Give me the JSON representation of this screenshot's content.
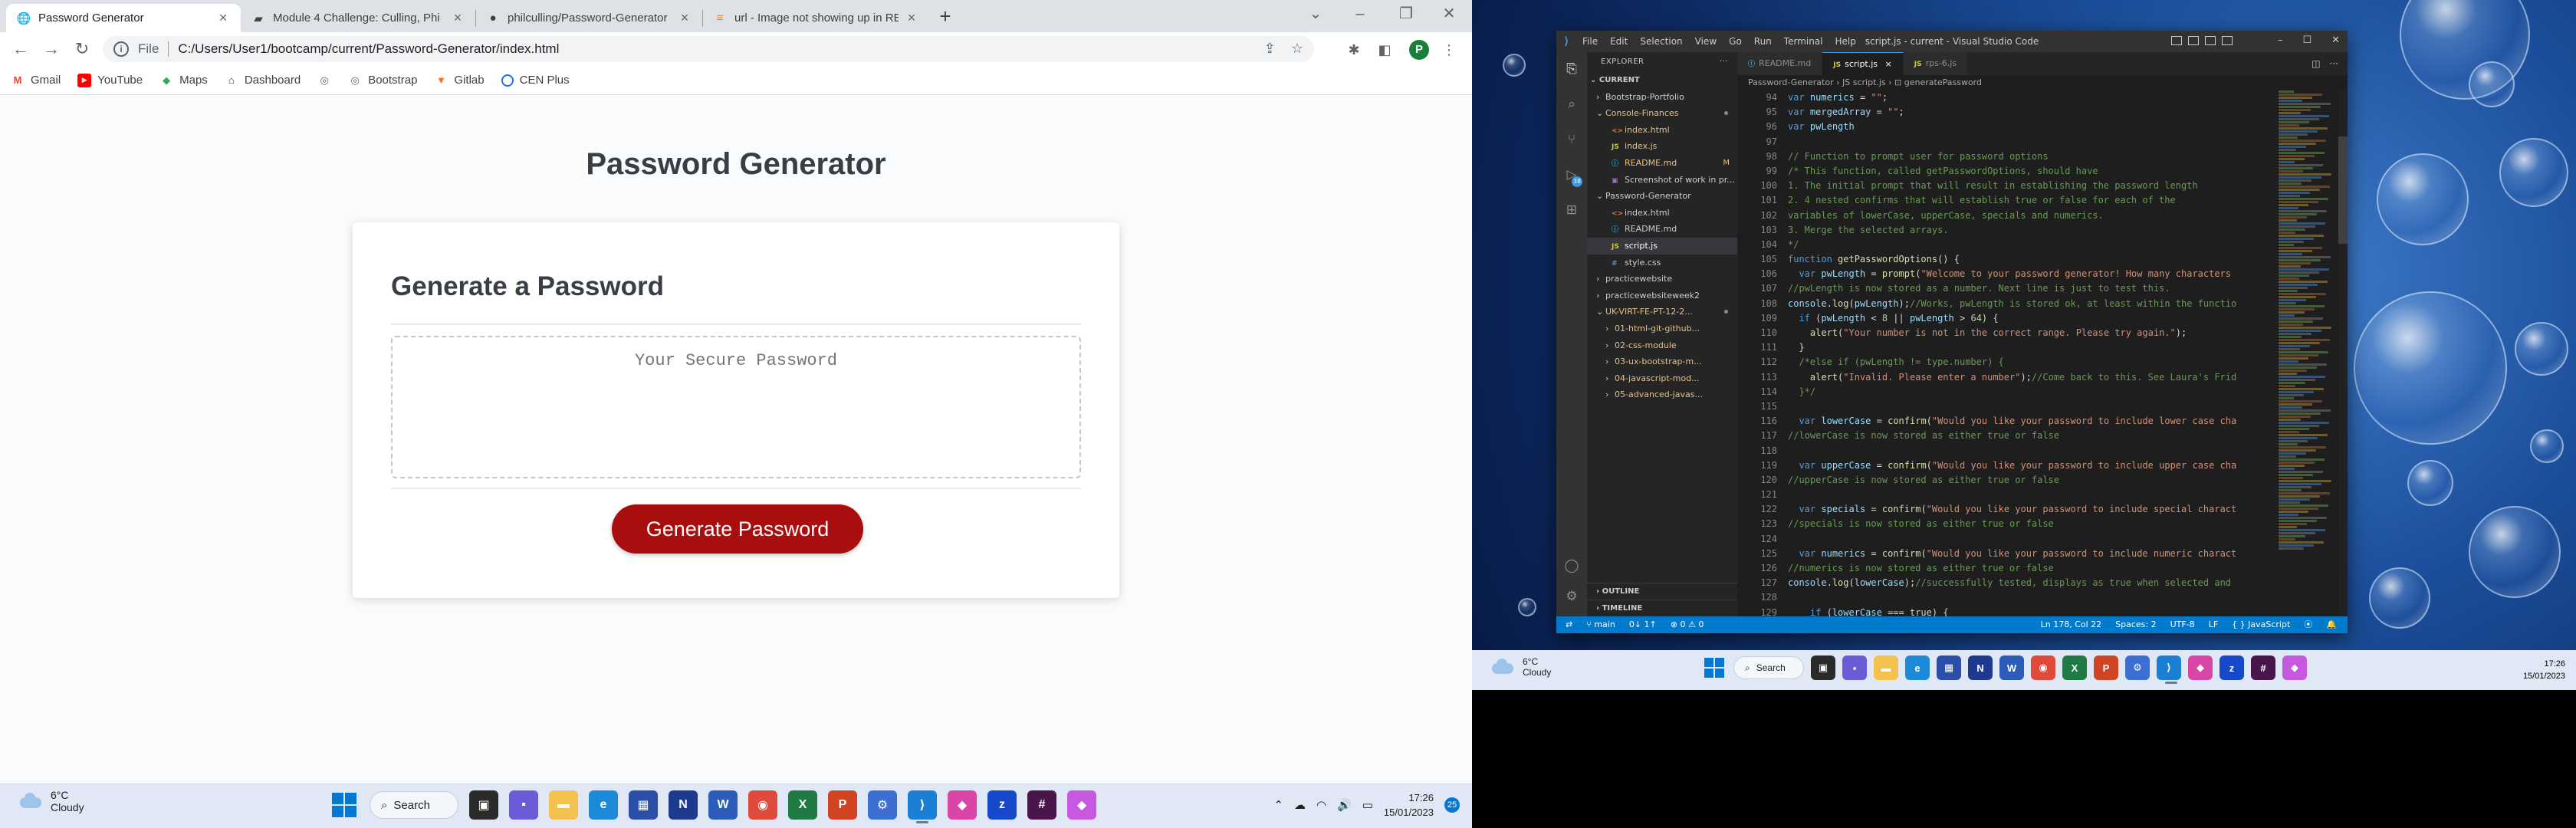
{
  "browser": {
    "tabs": [
      {
        "title": "Password Generator",
        "active": true
      },
      {
        "title": "Module 4 Challenge: Culling, Phi",
        "active": false
      },
      {
        "title": "philculling/Password-Generator",
        "active": false
      },
      {
        "title": "url - Image not showing up in RE",
        "active": false
      }
    ],
    "address": {
      "scheme_label": "File",
      "url": "C:/Users/User1/bootcamp/current/Password-Generator/index.html"
    },
    "profile_initial": "P",
    "bookmarks": [
      "Gmail",
      "YouTube",
      "Maps",
      "Dashboard",
      "Bootstrap",
      "Gitlab",
      "CEN Plus"
    ]
  },
  "app": {
    "page_title": "Password Generator",
    "card_title": "Generate a Password",
    "password_placeholder": "Your Secure Password",
    "generate_button": "Generate Password"
  },
  "taskbar_left": {
    "weather_temp": "6°C",
    "weather_desc": "Cloudy",
    "search_label": "Search",
    "time": "17:26",
    "date": "15/01/2023",
    "notifications": "25"
  },
  "vscode": {
    "menu": [
      "File",
      "Edit",
      "Selection",
      "View",
      "Go",
      "Run",
      "Terminal",
      "Help"
    ],
    "window_title": "script.js - current - Visual Studio Code",
    "explorer_label": "EXPLORER",
    "section_label": "CURRENT",
    "scm_badge": "38",
    "tree": [
      {
        "label": "Bootstrap-Portfolio",
        "kind": "folder",
        "indent": 1,
        "open": false,
        "color": "#cccccc"
      },
      {
        "label": "Console-Finances",
        "kind": "folder",
        "indent": 1,
        "open": true,
        "color": "#e2c08d",
        "dot": true
      },
      {
        "label": "index.html",
        "kind": "html",
        "indent": 2,
        "color": "#e2c08d"
      },
      {
        "label": "index.js",
        "kind": "js",
        "indent": 2,
        "color": "#e2c08d"
      },
      {
        "label": "README.md",
        "kind": "md",
        "indent": 2,
        "color": "#e2c08d",
        "flag": "M"
      },
      {
        "label": "Screenshot of work in pr...",
        "kind": "img",
        "indent": 2,
        "color": "#cccccc"
      },
      {
        "label": "Password-Generator",
        "kind": "folder",
        "indent": 1,
        "open": true,
        "color": "#cccccc"
      },
      {
        "label": "index.html",
        "kind": "html",
        "indent": 2,
        "color": "#cccccc"
      },
      {
        "label": "README.md",
        "kind": "md",
        "indent": 2,
        "color": "#cccccc"
      },
      {
        "label": "script.js",
        "kind": "js",
        "indent": 2,
        "color": "#ffffff",
        "selected": true
      },
      {
        "label": "style.css",
        "kind": "css",
        "indent": 2,
        "color": "#cccccc"
      },
      {
        "label": "practicewebsite",
        "kind": "folder",
        "indent": 1,
        "open": false,
        "color": "#cccccc"
      },
      {
        "label": "practicewebsiteweek2",
        "kind": "folder",
        "indent": 1,
        "open": false,
        "color": "#cccccc"
      },
      {
        "label": "UK-VIRT-FE-PT-12-2...",
        "kind": "folder",
        "indent": 1,
        "open": true,
        "color": "#e2c08d",
        "dot": true
      },
      {
        "label": "01-html-git-github...",
        "kind": "folder",
        "indent": 2,
        "open": false,
        "color": "#e2c08d"
      },
      {
        "label": "02-css-module",
        "kind": "folder",
        "indent": 2,
        "open": false,
        "color": "#e2c08d"
      },
      {
        "label": "03-ux-bootstrap-m...",
        "kind": "folder",
        "indent": 2,
        "open": false,
        "color": "#e2c08d"
      },
      {
        "label": "04-javascript-mod...",
        "kind": "folder",
        "indent": 2,
        "open": false,
        "color": "#e2c08d"
      },
      {
        "label": "05-advanced-javas...",
        "kind": "folder",
        "indent": 2,
        "open": false,
        "color": "#e2c08d"
      }
    ],
    "outline_label": "OUTLINE",
    "timeline_label": "TIMELINE",
    "tabs": [
      {
        "label": "README.md",
        "kind": "md",
        "active": false
      },
      {
        "label": "script.js",
        "kind": "js",
        "active": true
      },
      {
        "label": "rps-6.js",
        "kind": "js",
        "active": false
      }
    ],
    "breadcrumb": "Password-Generator  ›  JS script.js  ›  ⊡ generatePassword",
    "code_lines": [
      {
        "n": "94",
        "t": "var numerics = \"\";"
      },
      {
        "n": "95",
        "t": "var mergedArray = \"\";"
      },
      {
        "n": "96",
        "t": "var pwLength"
      },
      {
        "n": "97",
        "t": ""
      },
      {
        "n": "98",
        "t": "// Function to prompt user for password options"
      },
      {
        "n": "99",
        "t": "/* This function, called getPasswordOptions, should have"
      },
      {
        "n": "100",
        "t": "1. The initial prompt that will result in establishing the password length"
      },
      {
        "n": "101",
        "t": "2. 4 nested confirms that will establish true or false for each of the"
      },
      {
        "n": "102",
        "t": "variables of lowerCase, upperCase, specials and numerics."
      },
      {
        "n": "103",
        "t": "3. Merge the selected arrays."
      },
      {
        "n": "104",
        "t": "*/"
      },
      {
        "n": "105",
        "t": "function getPasswordOptions() {"
      },
      {
        "n": "106",
        "t": "  var pwLength = prompt(\"Welcome to your password generator! How many characters"
      },
      {
        "n": "107",
        "t": "//pwLength is now stored as a number. Next line is just to test this."
      },
      {
        "n": "108",
        "t": "console.log(pwLength);//Works, pwLength is stored ok, at least within the functio"
      },
      {
        "n": "109",
        "t": "  if (pwLength < 8 || pwLength > 64) {"
      },
      {
        "n": "110",
        "t": "    alert(\"Your number is not in the correct range. Please try again.\");"
      },
      {
        "n": "111",
        "t": "  }"
      },
      {
        "n": "112",
        "t": "  /*else if (pwLength != type.number) {"
      },
      {
        "n": "113",
        "t": "    alert(\"Invalid. Please enter a number\");//Come back to this. See Laura's Frid"
      },
      {
        "n": "114",
        "t": "  }*/"
      },
      {
        "n": "115",
        "t": ""
      },
      {
        "n": "116",
        "t": "  var lowerCase = confirm(\"Would you like your password to include lower case cha"
      },
      {
        "n": "117",
        "t": "//lowerCase is now stored as either true or false"
      },
      {
        "n": "118",
        "t": ""
      },
      {
        "n": "119",
        "t": "  var upperCase = confirm(\"Would you like your password to include upper case cha"
      },
      {
        "n": "120",
        "t": "//upperCase is now stored as either true or false"
      },
      {
        "n": "121",
        "t": ""
      },
      {
        "n": "122",
        "t": "  var specials = confirm(\"Would you like your password to include special charact"
      },
      {
        "n": "123",
        "t": "//specials is now stored as either true or false"
      },
      {
        "n": "124",
        "t": ""
      },
      {
        "n": "125",
        "t": "  var numerics = confirm(\"Would you like your password to include numeric charact"
      },
      {
        "n": "126",
        "t": "//numerics is now stored as either true or false"
      },
      {
        "n": "127",
        "t": "console.log(lowerCase);//successfully tested, displays as true when selected and"
      },
      {
        "n": "128",
        "t": ""
      },
      {
        "n": "129",
        "t": "    if (lowerCase === true) {"
      }
    ],
    "status": {
      "branch": "main",
      "sync": "0↓ 1↑",
      "problems": "⊗ 0 ⚠ 0",
      "position": "Ln 178, Col 22",
      "spaces": "Spaces: 2",
      "encoding": "UTF-8",
      "eol": "LF",
      "language": "{ } JavaScript"
    }
  },
  "taskbar_right": {
    "weather_temp": "6°C",
    "weather_desc": "Cloudy",
    "search_label": "Search",
    "time": "17:26",
    "date": "15/01/2023"
  }
}
